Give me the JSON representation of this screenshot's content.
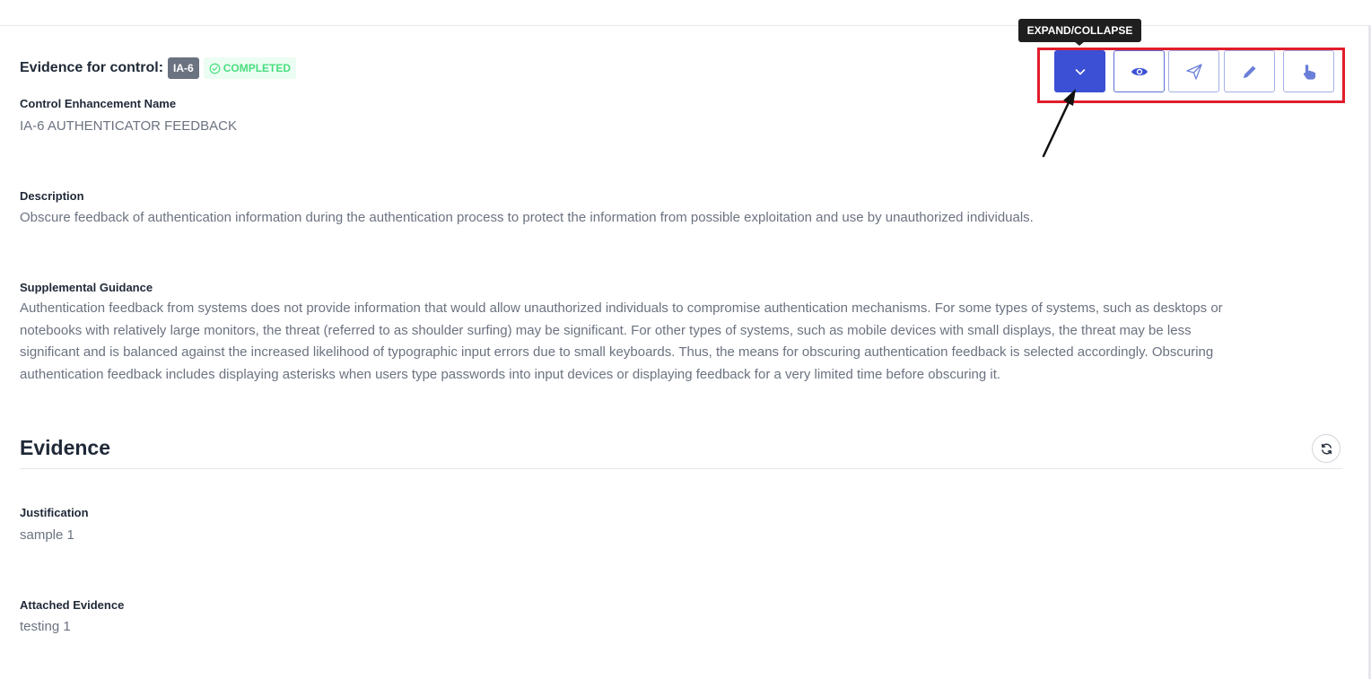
{
  "header": {
    "title": "Evidence for control:",
    "control_badge": "IA-6",
    "status_badge": "COMPLETED"
  },
  "control_enhancement": {
    "label": "Control Enhancement Name",
    "value": "IA-6 AUTHENTICATOR FEEDBACK"
  },
  "description": {
    "label": "Description",
    "value": "Obscure feedback of authentication information during the authentication process to protect the information from possible exploitation and use by unauthorized individuals."
  },
  "supplemental_guidance": {
    "label": "Supplemental Guidance",
    "lines": [
      "Authentication feedback from systems does not provide information that would allow unauthorized individuals to compromise authentication mechanisms. For some types of systems, such as desktops or",
      "notebooks with relatively large monitors, the threat (referred to as shoulder surfing) may be significant. For other types of systems, such as mobile devices with small displays, the threat may be less",
      "significant and is balanced against the increased likelihood of typographic input errors due to small keyboards. Thus, the means for obscuring authentication feedback is selected accordingly. Obscuring",
      "authentication feedback includes displaying asterisks when users type passwords into input devices or displaying feedback for a very limited time before obscuring it."
    ]
  },
  "evidence": {
    "heading": "Evidence",
    "justification_label": "Justification",
    "justification_value": "sample 1",
    "attached_label": "Attached Evidence",
    "attached_value": "testing 1"
  },
  "toolbar": {
    "tooltip": "EXPAND/COLLAPSE",
    "buttons": [
      {
        "icon": "chevron-down-icon",
        "active": true
      },
      {
        "icon": "eye-icon",
        "active": false
      },
      {
        "icon": "send-icon",
        "active": false
      },
      {
        "icon": "pencil-icon",
        "active": false
      },
      {
        "icon": "hand-pointer-icon",
        "active": false
      }
    ]
  },
  "colors": {
    "primary": "#3b50d4",
    "completed": "#4ade80",
    "highlight": "#e11d2b"
  }
}
